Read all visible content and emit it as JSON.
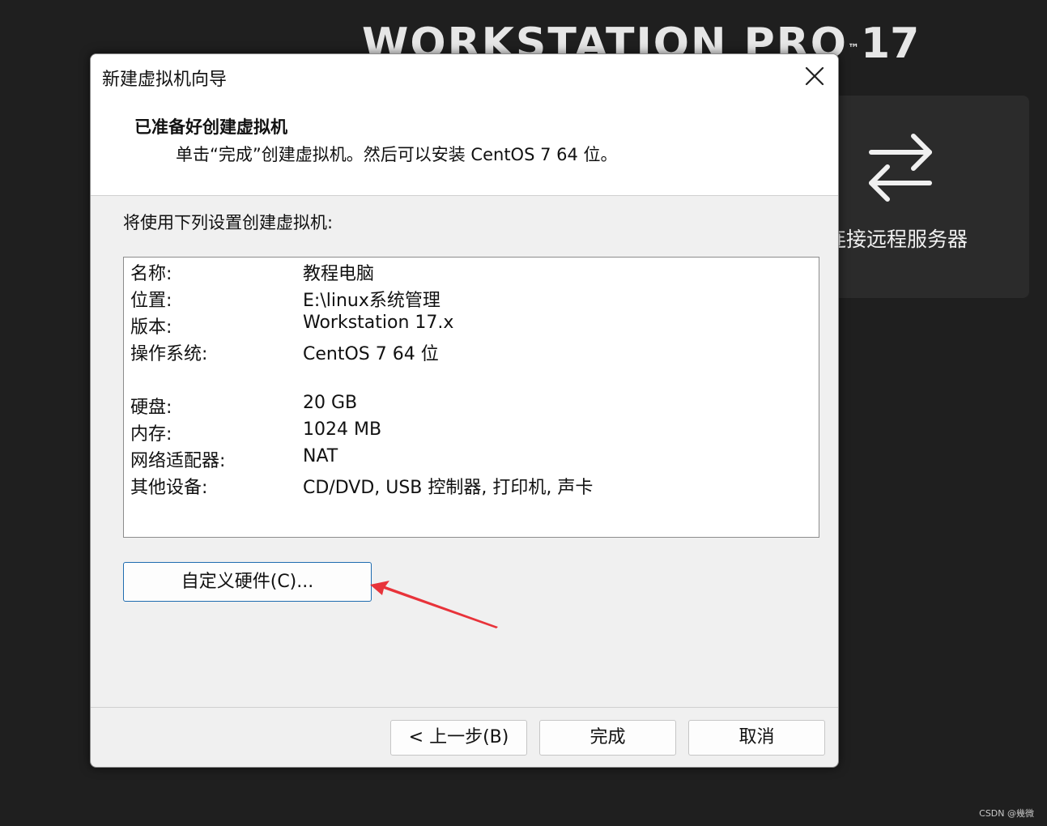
{
  "background": {
    "brand_text": "WORKSTATION PRO",
    "brand_tm": "™",
    "brand_version": "17",
    "remote_card": {
      "label": "连接远程服务器",
      "icon": "swap-arrows-icon"
    }
  },
  "dialog": {
    "title": "新建虚拟机向导",
    "close_icon": "close-icon",
    "header_title": "已准备好创建虚拟机",
    "header_subtitle": "单击“完成”创建虚拟机。然后可以安装 CentOS 7 64 位。",
    "intro_text": "将使用下列设置创建虚拟机:",
    "summary": [
      {
        "key": "名称:",
        "value": "教程电脑"
      },
      {
        "key": "位置:",
        "value": "E:\\linux系统管理"
      },
      {
        "key": "版本:",
        "value": "Workstation 17.x"
      },
      {
        "key": "操作系统:",
        "value": "CentOS 7 64 位"
      },
      {
        "key": "硬盘:",
        "value": "20 GB"
      },
      {
        "key": "内存:",
        "value": "1024 MB"
      },
      {
        "key": "网络适配器:",
        "value": "NAT"
      },
      {
        "key": "其他设备:",
        "value": "CD/DVD, USB 控制器, 打印机, 声卡"
      }
    ],
    "customize_button": "自定义硬件(C)...",
    "buttons": {
      "back": "< 上一步(B)",
      "finish": "完成",
      "cancel": "取消"
    }
  },
  "annotation": {
    "color": "#e8333a",
    "icon": "red-arrow-annotation"
  },
  "watermark": "CSDN @幾微"
}
